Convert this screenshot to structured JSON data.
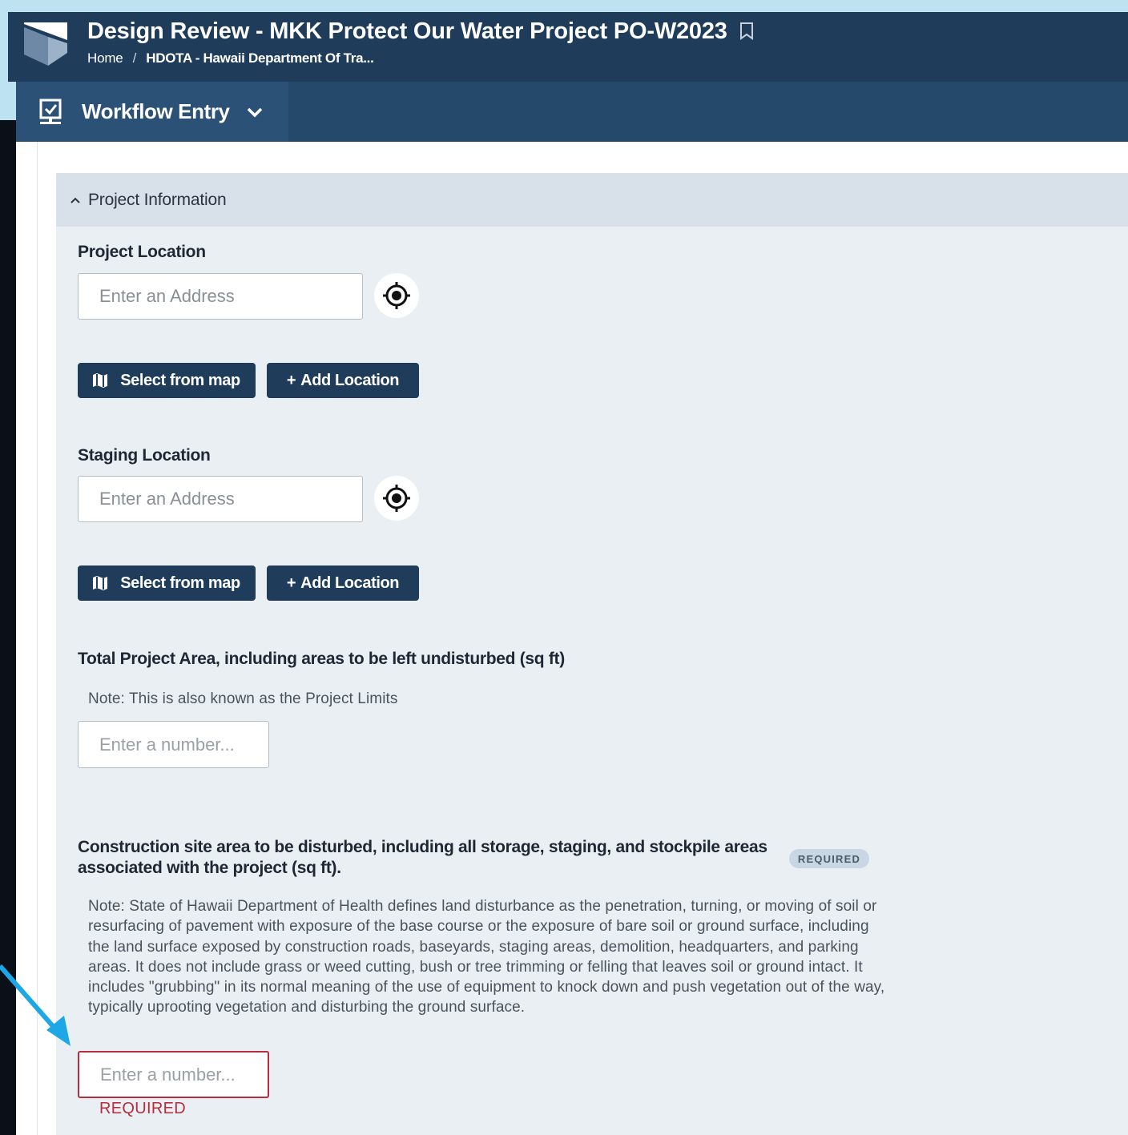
{
  "header": {
    "title": "Design Review - MKK Protect Our Water Project PO-W2023",
    "breadcrumb_home": "Home",
    "breadcrumb_separator": "/",
    "breadcrumb_org": "HDOTA - Hawaii Department Of Tra...",
    "bookmark_icon": "bookmark-icon",
    "logo": "app-logo"
  },
  "workflow": {
    "label": "Workflow Entry",
    "icon": "workflow-monitor-icon",
    "chevron": "chevron-down-icon"
  },
  "section": {
    "title": "Project Information"
  },
  "project_location": {
    "label": "Project Location",
    "placeholder": "Enter an Address",
    "select_map_label": "Select from map",
    "add_location_label": "Add Location"
  },
  "staging_location": {
    "label": "Staging Location",
    "placeholder": "Enter an Address",
    "select_map_label": "Select from map",
    "add_location_label": "Add Location"
  },
  "total_area": {
    "label": "Total Project Area, including areas to be left undisturbed (sq ft)",
    "note": "Note: This is also known as the Project Limits",
    "placeholder": "Enter a number..."
  },
  "disturbed_area": {
    "label": "Construction site area to be disturbed, including all storage, staging, and stockpile areas associated with the project (sq ft).",
    "badge": "REQUIRED",
    "note": "Note: State of Hawaii Department of Health defines land disturbance as the penetration, turning, or moving of soil or resurfacing of pavement with exposure of the base course or the exposure of bare soil or ground surface, including the land surface exposed by construction roads, baseyards, staging areas, demolition, headquarters, and parking areas.  It does not include grass or weed cutting, bush or tree trimming or felling that leaves soil or ground intact.  It includes \"grubbing\" in its normal meaning of the use of equipment to knock down and push vegetation out of the way, typically uprooting vegetation and disturbing the ground surface.",
    "placeholder": "Enter a number...",
    "error": "REQUIRED"
  },
  "colors": {
    "header_bg": "#1f3d5a",
    "workflow_bg": "#24496b",
    "annotation_arrow": "#1ea7e6",
    "error": "#b62d3f"
  }
}
